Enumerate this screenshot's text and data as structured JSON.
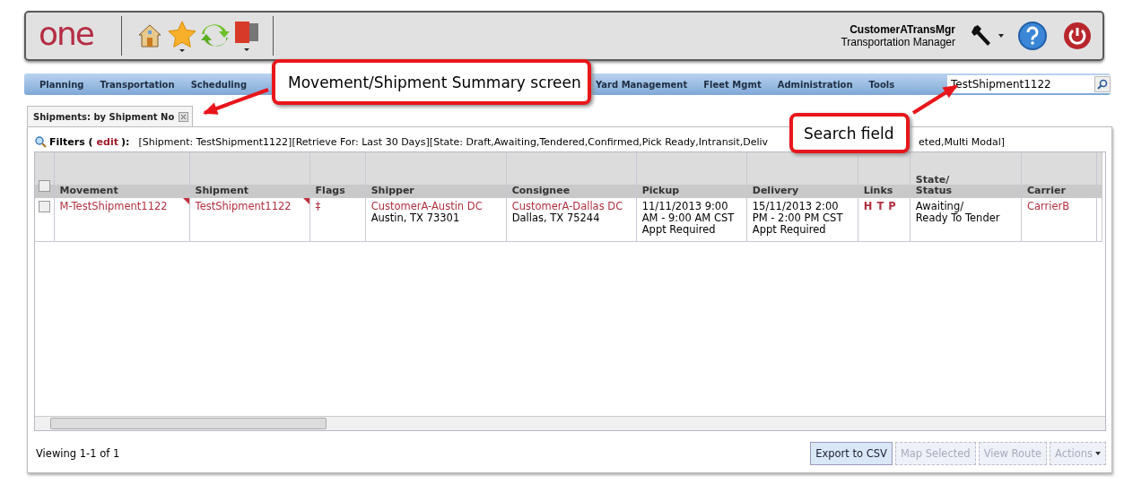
{
  "header": {
    "logo": "one",
    "user_name": "CustomerATransMgr",
    "user_role": "Transportation Manager"
  },
  "nav": {
    "items_before": [
      "Planning",
      "Transportation",
      "Scheduling"
    ],
    "items_after": [
      "Yard Management",
      "Fleet Mgmt",
      "Administration",
      "Tools"
    ],
    "search_value": "TestShipment1122"
  },
  "tab": {
    "label": "Shipments: by Shipment No"
  },
  "filters": {
    "label": "Filters (",
    "edit": "edit",
    "label_end": "):",
    "text_before": "[Shipment: TestShipment1122][Retrieve For: Last 30 Days][State: Draft,Awaiting,Tendered,Confirmed,Pick Ready,Intransit,Deliv",
    "text_after": "eted,Multi Modal]"
  },
  "grid": {
    "all_checked": false,
    "columns": [
      [
        "Movement"
      ],
      [
        "Shipment"
      ],
      [
        "Flags"
      ],
      [
        "Shipper"
      ],
      [
        "Consignee"
      ],
      [
        "Pickup"
      ],
      [
        "Delivery"
      ],
      [
        "Links"
      ],
      [
        "State/",
        "Status"
      ],
      [
        "Carrier"
      ]
    ],
    "rows": [
      {
        "checked": false,
        "movement": "M-TestShipment1122",
        "shipment": "TestShipment1122",
        "flags": "‡",
        "shipper": {
          "name": "CustomerA-Austin DC",
          "address": "Austin, TX 73301"
        },
        "consignee": {
          "name": "CustomerA-Dallas DC",
          "address": "Dallas, TX 75244"
        },
        "pickup": [
          "11/11/2013 9:00 AM - 9:00 AM CST",
          "Appt Required"
        ],
        "delivery": [
          "15/11/2013 2:00 PM - 2:00 PM CST",
          "Appt Required"
        ],
        "links": [
          "H",
          "T",
          "P"
        ],
        "status": [
          "Awaiting/",
          "Ready To Tender"
        ],
        "carrier": "CarrierB"
      }
    ]
  },
  "footer": {
    "viewing": "Viewing 1-1 of 1",
    "buttons": [
      {
        "label": "Export to CSV",
        "disabled": false,
        "kind": "plain"
      },
      {
        "label": "Map Selected",
        "disabled": true,
        "kind": "plain"
      },
      {
        "label": "View Route",
        "disabled": true,
        "kind": "plain"
      },
      {
        "label": "Actions",
        "disabled": true,
        "kind": "menu"
      }
    ]
  },
  "callouts": [
    {
      "text": "Movement/Shipment Summary screen"
    },
    {
      "text": "Search field"
    }
  ]
}
